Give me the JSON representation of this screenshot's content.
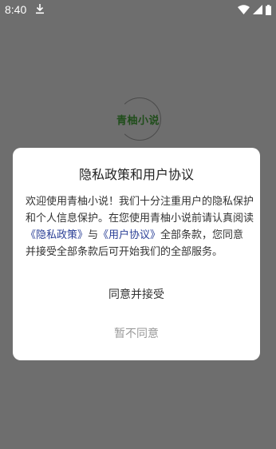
{
  "status_bar": {
    "time": "8:40",
    "icons": [
      "download-icon",
      "wifi-icon",
      "signal-icon",
      "battery-icon"
    ]
  },
  "logo": {
    "text": "青柚小说"
  },
  "dialog": {
    "title": "隐私政策和用户协议",
    "body_part1": "欢迎使用青柚小说！我们十分注重用户的隐私保护和个人信息保护。在您使用青柚小说前请认真阅读",
    "privacy_link": "《隐私政策》",
    "connector": "与",
    "agreement_link": "《用户协议》",
    "body_part2": "全部条款，您同意并接受全部条款后可开始我们的全部服务。",
    "agree_label": "同意并接受",
    "disagree_label": "暂不同意"
  },
  "colors": {
    "overlay": "#6e6e6e",
    "link": "#2a3f96",
    "muted": "#9a9a9a"
  }
}
